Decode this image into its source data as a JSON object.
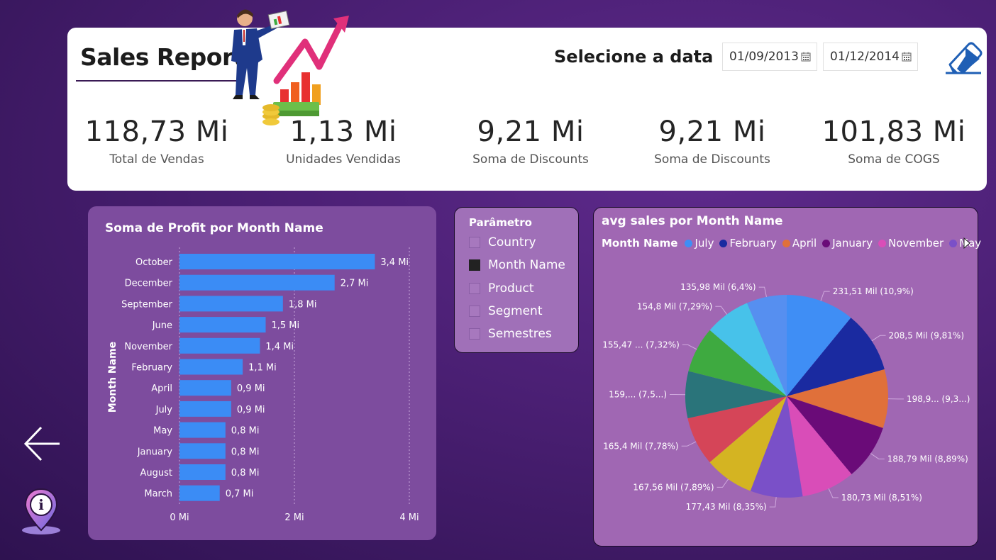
{
  "header": {
    "title": "Sales Report",
    "date_label": "Selecione a data",
    "date_start": "01/09/2013",
    "date_end": "01/12/2014"
  },
  "kpis": [
    {
      "value": "118,73 Mi",
      "label": "Total de Vendas"
    },
    {
      "value": "1,13 Mi",
      "label": "Unidades Vendidas"
    },
    {
      "value": "9,21 Mi",
      "label": "Soma de Discounts"
    },
    {
      "value": "9,21 Mi",
      "label": "Soma de Discounts"
    },
    {
      "value": "101,83 Mi",
      "label": "Soma de COGS"
    }
  ],
  "param": {
    "title": "Parâmetro",
    "items": [
      {
        "label": "Country",
        "checked": false
      },
      {
        "label": "Month Name",
        "checked": true
      },
      {
        "label": "Product",
        "checked": false
      },
      {
        "label": "Segment",
        "checked": false
      },
      {
        "label": "Semestres",
        "checked": false
      }
    ]
  },
  "bar_chart": {
    "title": "Soma de Profit por Month Name"
  },
  "pie_chart": {
    "title": "avg sales por Month Name",
    "legend_title": "Month Name"
  },
  "colors": {
    "bar": "#3b8cf5",
    "accent": "#a067b3"
  },
  "chart_data": [
    {
      "type": "bar",
      "orientation": "horizontal",
      "title": "Soma de Profit por Month Name",
      "ylabel": "Month Name",
      "xlabel": "",
      "categories": [
        "October",
        "December",
        "September",
        "June",
        "November",
        "February",
        "April",
        "July",
        "May",
        "January",
        "August",
        "March"
      ],
      "values": [
        3.4,
        2.7,
        1.8,
        1.5,
        1.4,
        1.1,
        0.9,
        0.9,
        0.8,
        0.8,
        0.8,
        0.7
      ],
      "data_labels": [
        "3,4 Mi",
        "2,7 Mi",
        "1,8 Mi",
        "1,5 Mi",
        "1,4 Mi",
        "1,1 Mi",
        "0,9 Mi",
        "0,9 Mi",
        "0,8 Mi",
        "0,8 Mi",
        "0,8 Mi",
        "0,7 Mi"
      ],
      "xlim": [
        0,
        4
      ],
      "x_ticks": [
        0,
        2,
        4
      ],
      "x_tick_labels": [
        "0 Mi",
        "2 Mi",
        "4 Mi"
      ],
      "grid": true
    },
    {
      "type": "pie",
      "title": "avg sales por Month Name",
      "legend_title": "Month Name",
      "legend_visible": [
        "July",
        "February",
        "April",
        "January",
        "November",
        "May"
      ],
      "values": [
        231.51,
        208.5,
        198.9,
        188.79,
        180.73,
        177.43,
        167.56,
        165.4,
        159,
        155.47,
        154.8,
        135.98
      ],
      "labels": [
        "231,51 Mil (10,9%)",
        "208,5 Mil (9,81%)",
        "198,9... (9,3...)",
        "188,79 Mil (8,89%)",
        "180,73 Mil (8,51%)",
        "177,43 Mil (8,35%)",
        "167,56 Mil (7,89%)",
        "165,4 Mil (7,78%)",
        "159,... (7,5...)",
        "155,47 ... (7,32%)",
        "154,8 Mil (7,29%)",
        "135,98 Mil (6,4%)"
      ],
      "colors": [
        "#3f8ef5",
        "#1a2aa0",
        "#e0703a",
        "#6a0b78",
        "#d94db8",
        "#7a50c8",
        "#d4b422",
        "#d54558",
        "#2a747a",
        "#3eaa40",
        "#47c2ea",
        "#568ff0"
      ],
      "legend_colors": [
        "#3f8ef5",
        "#1a2aa0",
        "#e0703a",
        "#6a0b78",
        "#d94db8",
        "#7a50c8"
      ]
    }
  ]
}
